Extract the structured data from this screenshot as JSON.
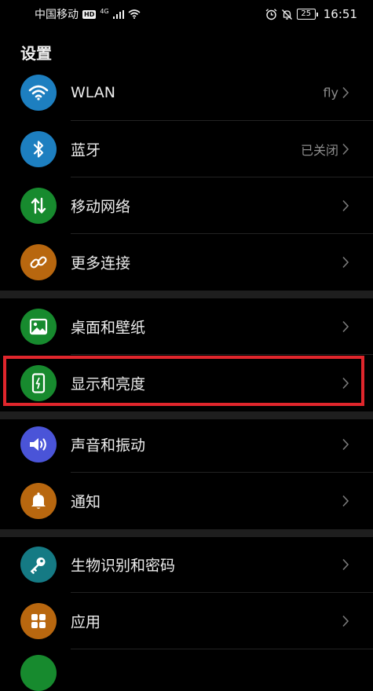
{
  "status_bar": {
    "carrier": "中国移动",
    "hd": "HD",
    "network": "4G",
    "battery": "25",
    "time": "16:51"
  },
  "page_title": "设置",
  "colors": {
    "wlan": "#1d7fc0",
    "bluetooth": "#1d7fc0",
    "mobile": "#178a2e",
    "more": "#b8670f",
    "wallpaper": "#178a2e",
    "display": "#178a2e",
    "sound": "#4a54d8",
    "notification": "#b8670f",
    "biometric": "#157a84",
    "apps": "#b8670f",
    "highlight": "#e0262c"
  },
  "items": [
    {
      "id": "wlan",
      "label": "WLAN",
      "value": "fly",
      "icon": "wifi-icon"
    },
    {
      "id": "bluetooth",
      "label": "蓝牙",
      "value": "已关闭",
      "icon": "bluetooth-icon"
    },
    {
      "id": "mobile-network",
      "label": "移动网络",
      "value": "",
      "icon": "mobile-data-icon"
    },
    {
      "id": "more-connections",
      "label": "更多连接",
      "value": "",
      "icon": "link-icon"
    },
    {
      "id": "wallpaper",
      "label": "桌面和壁纸",
      "value": "",
      "icon": "image-icon"
    },
    {
      "id": "display",
      "label": "显示和亮度",
      "value": "",
      "icon": "phone-brightness-icon"
    },
    {
      "id": "sound",
      "label": "声音和振动",
      "value": "",
      "icon": "speaker-icon"
    },
    {
      "id": "notification",
      "label": "通知",
      "value": "",
      "icon": "bell-icon"
    },
    {
      "id": "biometric",
      "label": "生物识别和密码",
      "value": "",
      "icon": "key-icon"
    },
    {
      "id": "apps",
      "label": "应用",
      "value": "",
      "icon": "apps-grid-icon"
    }
  ]
}
